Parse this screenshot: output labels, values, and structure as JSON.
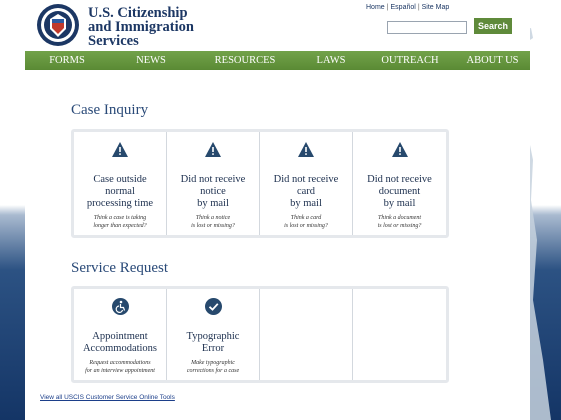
{
  "header": {
    "agency_lines": [
      "U.S. Citizenship",
      "and Immigration",
      "Services"
    ],
    "seal_alt": "department-of-homeland-security-seal",
    "top_links": [
      "Home",
      "Español",
      "Site Map"
    ],
    "search_button": "Search",
    "search_placeholder": ""
  },
  "nav": {
    "items": [
      "FORMS",
      "NEWS",
      "RESOURCES",
      "LAWS",
      "OUTREACH",
      "ABOUT US"
    ]
  },
  "case_inquiry": {
    "title": "Case Inquiry",
    "cards": [
      {
        "icon": "warning-icon",
        "title_lines": [
          "Case outside",
          "normal",
          "processing time"
        ],
        "sub_lines": [
          "Think a case is taking",
          "longer than expected?"
        ]
      },
      {
        "icon": "warning-icon",
        "title_lines": [
          "Did not receive",
          "notice",
          "by mail"
        ],
        "sub_lines": [
          "Think a notice",
          "is lost or missing?"
        ]
      },
      {
        "icon": "warning-icon",
        "title_lines": [
          "Did not receive",
          "card",
          "by mail"
        ],
        "sub_lines": [
          "Think a card",
          "is lost or missing?"
        ]
      },
      {
        "icon": "warning-icon",
        "title_lines": [
          "Did not receive",
          "document",
          "by mail"
        ],
        "sub_lines": [
          "Think a document",
          "is lost or missing?"
        ]
      }
    ]
  },
  "service_request": {
    "title": "Service Request",
    "cards": [
      {
        "icon": "wheelchair-icon",
        "title_lines": [
          "Appointment",
          "Accommodations"
        ],
        "sub_lines": [
          "Request accommodations",
          "for an interview appointment"
        ]
      },
      {
        "icon": "checkmark-icon",
        "title_lines": [
          "Typographic",
          "Error"
        ],
        "sub_lines": [
          "Make typographic",
          "corrections for a case"
        ]
      }
    ]
  },
  "footer": {
    "link": "View all USCIS Customer Service Online Tools"
  },
  "colors": {
    "nav_green": "#5f8a3a",
    "brand_navy": "#1c3764",
    "icon_navy": "#27496d"
  }
}
